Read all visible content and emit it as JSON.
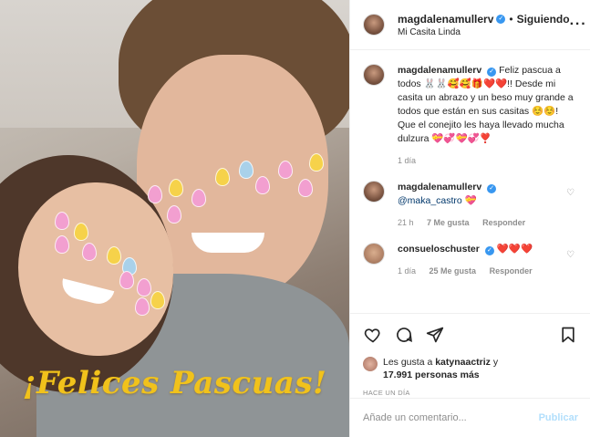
{
  "header": {
    "username": "magdalenamullerv",
    "follow_status": "Siguiendo",
    "location": "Mi Casita Linda",
    "more_icon": "more-horizontal-icon"
  },
  "photo": {
    "overlay_text": "¡Felices Pascuas!"
  },
  "caption": {
    "username": "magdalenamullerv",
    "text": "Feliz pascua a todos 🐰🐰🥰🥰🎁❤️❤️!! Desde mi casita un abrazo y un beso muy grande a todos que están en sus casitas ☺️☺️! Que el conejito les haya llevado mucha dulzura 💝💞💝💞❣️",
    "time": "1 día"
  },
  "comments": [
    {
      "username": "magdalenamullerv",
      "text": "@maka_castro 💝",
      "time": "21 h",
      "likes": "7 Me gusta",
      "reply": "Responder"
    },
    {
      "username": "consueloschuster",
      "text": "❤️❤️❤️",
      "time": "1 día",
      "likes": "25 Me gusta",
      "reply": "Responder"
    }
  ],
  "actions": {
    "like_icon": "heart-icon",
    "comment_icon": "comment-icon",
    "share_icon": "share-icon",
    "save_icon": "bookmark-icon"
  },
  "likes": {
    "prefix": "Les gusta a",
    "user": "katynaactriz",
    "connector": "y",
    "count": "17.991 personas más"
  },
  "timestamp": "HACE UN DÍA",
  "add_comment": {
    "placeholder": "Añade un comentario...",
    "publish_label": "Publicar"
  }
}
